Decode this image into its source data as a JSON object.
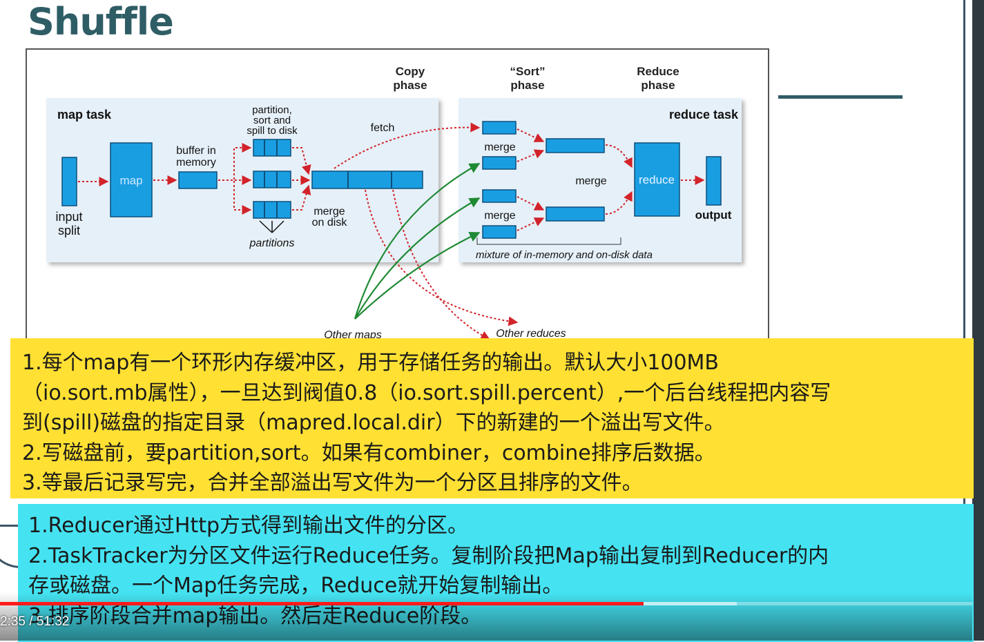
{
  "slide": {
    "title": "Shuffle"
  },
  "diagram": {
    "phase_labels": {
      "copy": [
        "Copy",
        "phase"
      ],
      "sort": [
        "“Sort”",
        "phase"
      ],
      "reduce": [
        "Reduce",
        "phase"
      ]
    },
    "map_task": {
      "title": "map task",
      "input_split": [
        "input",
        "split"
      ],
      "map_label": "map",
      "buffer": [
        "buffer in",
        "memory"
      ],
      "partition_note": [
        "partition,",
        "sort and",
        "spill to disk"
      ],
      "partitions": "partitions",
      "merge_on_disk": [
        "merge",
        "on disk"
      ]
    },
    "fetch": "fetch",
    "reduce_task": {
      "title": "reduce task",
      "merge_top": "merge",
      "merge_bottom": "merge",
      "merge_middle": "merge",
      "reduce_label": "reduce",
      "output": "output",
      "mixture": "mixture of in-memory and on-disk data"
    },
    "other_maps": "Other maps",
    "other_reduces": "Other reduces",
    "colors": {
      "box": "#1a9ee2",
      "panel": "#e6f0f8",
      "red_arrow": "#d2232a",
      "green_arrow": "#1f8a34"
    }
  },
  "notes": {
    "map_side": [
      "1.每个map有一个环形内存缓冲区，用于存储任务的输出。默认大小100MB",
      "（io.sort.mb属性），一旦达到阀值0.8（io.sort.spill.percent）,一个后台线程把内容写",
      "到(spill)磁盘的指定目录（mapred.local.dir）下的新建的一个溢出写文件。",
      "2.写磁盘前，要partition,sort。如果有combiner，combine排序后数据。",
      "3.等最后记录写完，合并全部溢出写文件为一个分区且排序的文件。"
    ],
    "reduce_side": [
      "1.Reducer通过Http方式得到输出文件的分区。",
      "2.TaskTracker为分区文件运行Reduce任务。复制阶段把Map输出复制到Reducer的内",
      "存或磁盘。一个Map任务完成，Reduce就开始复制输出。",
      "3.排序阶段合并map输出。然后走Reduce阶段。"
    ]
  },
  "player": {
    "time": "2:35 / 51:32",
    "played_fraction": 0.662,
    "buffered_fraction": 0.758,
    "played_color": "#ff1a1a"
  }
}
